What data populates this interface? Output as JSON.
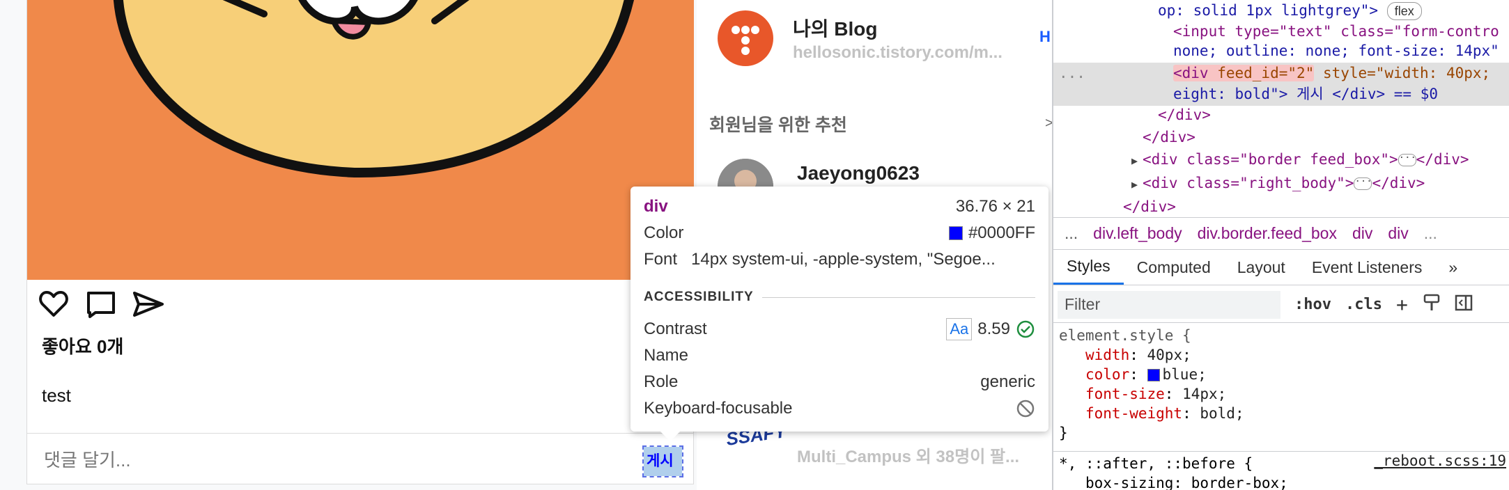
{
  "feed": {
    "likes_label": "좋아요 0개",
    "caption": "test",
    "comment_placeholder": "댓글 달기...",
    "post_button_label": "게시"
  },
  "sidebar": {
    "blog_title": "나의 Blog",
    "blog_url": "hellosonic.tistory.com/m...",
    "side_mark": "H",
    "recommend_title": "회원님을 위한 추천",
    "recommend_arrow": ">",
    "users": [
      {
        "name": "Jaeyong0623"
      },
      {
        "name": "",
        "logo_text": "SSAFY",
        "subtitle": "Multi_Campus 외 38명이 팔..."
      }
    ]
  },
  "tooltip": {
    "tag": "div",
    "size": "36.76 × 21",
    "color_label": "Color",
    "color_value": "#0000FF",
    "font_label": "Font",
    "font_value": "14px system-ui, -apple-system, \"Segoe...",
    "section": "ACCESSIBILITY",
    "contrast_label": "Contrast",
    "aa": "Aa",
    "contrast_value": "8.59",
    "name_label": "Name",
    "role_label": "Role",
    "role_value": "generic",
    "kbd_label": "Keyboard-focusable"
  },
  "devtools": {
    "dom": {
      "l1_text": "op: solid 1px lightgrey\">",
      "flex_badge": "flex",
      "l2": "<input type=\"text\" class=\"form-contro",
      "l3": "none; outline: none; font-size: 14px\"",
      "dots": "...",
      "l4_open": "<div ",
      "l4_attr": "feed_id=\"2\"",
      "l4_rest": " style=\"width: 40px;",
      "l5": "eight: bold\"> 게시 </div> == $0",
      "l6": "</div>",
      "l7": "</div>",
      "l8a": "<div class=\"border feed_box\">",
      "l8b": "</div>",
      "l9a": "<div class=\"right_body\">",
      "l9b": "</div>",
      "l10": "</div>"
    },
    "breadcrumbs": [
      "...",
      "div.left_body",
      "div.border.feed_box",
      "div",
      "div",
      "..."
    ],
    "tabs": [
      "Styles",
      "Computed",
      "Layout",
      "Event Listeners",
      "»"
    ],
    "filter_placeholder": "Filter",
    "hov": ":hov",
    "cls": ".cls",
    "plus": "+",
    "styles": {
      "selector": "element.style {",
      "props": [
        {
          "name": "width",
          "value": "40px;"
        },
        {
          "name": "color",
          "value": "blue;"
        },
        {
          "name": "font-size",
          "value": "14px;"
        },
        {
          "name": "font-weight",
          "value": "bold;"
        }
      ],
      "close": "}",
      "rule2_selector": "*, ::after, ::before {",
      "rule2_source": "_reboot.scss:19",
      "rule2_prop": "box-sizing: border-box;"
    }
  },
  "colors": {
    "accent": "#1a73e8",
    "inspected_text": "#0000ff",
    "blog_orange": "#e8572a",
    "image_bg": "#f0894a"
  }
}
